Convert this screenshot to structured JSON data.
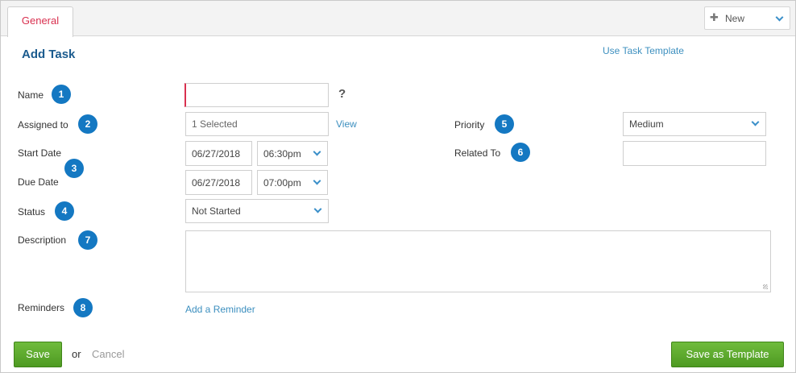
{
  "tabs": {
    "general": "General"
  },
  "new_dropdown": {
    "icon": "plus-icon",
    "label": "New"
  },
  "header": {
    "title": "Add Task",
    "use_template_link": "Use Task Template"
  },
  "fields": {
    "name": {
      "label": "Name",
      "badge": "1",
      "value": "",
      "help": "?"
    },
    "assigned": {
      "label": "Assigned to",
      "badge": "2",
      "value": "1 Selected",
      "view_link": "View"
    },
    "start_date": {
      "label": "Start Date",
      "date": "06/27/2018",
      "time": "06:30pm"
    },
    "due_date": {
      "label": "Due Date",
      "date": "06/27/2018",
      "time": "07:00pm"
    },
    "dates_badge": "3",
    "status": {
      "label": "Status",
      "badge": "4",
      "value": "Not Started"
    },
    "priority": {
      "label": "Priority",
      "badge": "5",
      "value": "Medium"
    },
    "related": {
      "label": "Related To",
      "badge": "6",
      "value": ""
    },
    "description": {
      "label": "Description",
      "badge": "7",
      "value": ""
    },
    "reminders": {
      "label": "Reminders",
      "badge": "8",
      "link": "Add a Reminder"
    }
  },
  "footer": {
    "save": "Save",
    "or": "or",
    "cancel": "Cancel",
    "save_template": "Save as Template"
  },
  "colors": {
    "accent_blue": "#1478c2",
    "tab_red": "#d9304f",
    "save_green": "#5aa82c",
    "link": "#3c8fbf"
  }
}
